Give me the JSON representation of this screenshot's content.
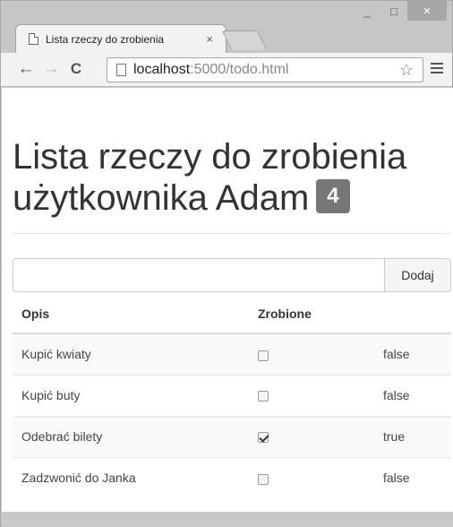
{
  "browser": {
    "tab_title": "Lista rzeczy do zrobienia",
    "tab_close": "×",
    "url_host": "localhost",
    "url_path": ":5000/todo.html",
    "controls": {
      "minimize": "_",
      "maximize": "□",
      "close": "×"
    },
    "back": "←",
    "forward": "→",
    "reload": "C",
    "star": "☆"
  },
  "page": {
    "title": "Lista rzeczy do zrobienia użytkownika Adam",
    "count": "4",
    "add_label": "Dodaj",
    "new_item_value": "",
    "columns": [
      "Opis",
      "Zrobione"
    ],
    "items": [
      {
        "description": "Kupić kwiaty",
        "done": false,
        "done_text": "false"
      },
      {
        "description": "Kupić buty",
        "done": false,
        "done_text": "false"
      },
      {
        "description": "Odebrać bilety",
        "done": true,
        "done_text": "true"
      },
      {
        "description": "Zadzwonić do Janka",
        "done": false,
        "done_text": "false"
      }
    ]
  }
}
